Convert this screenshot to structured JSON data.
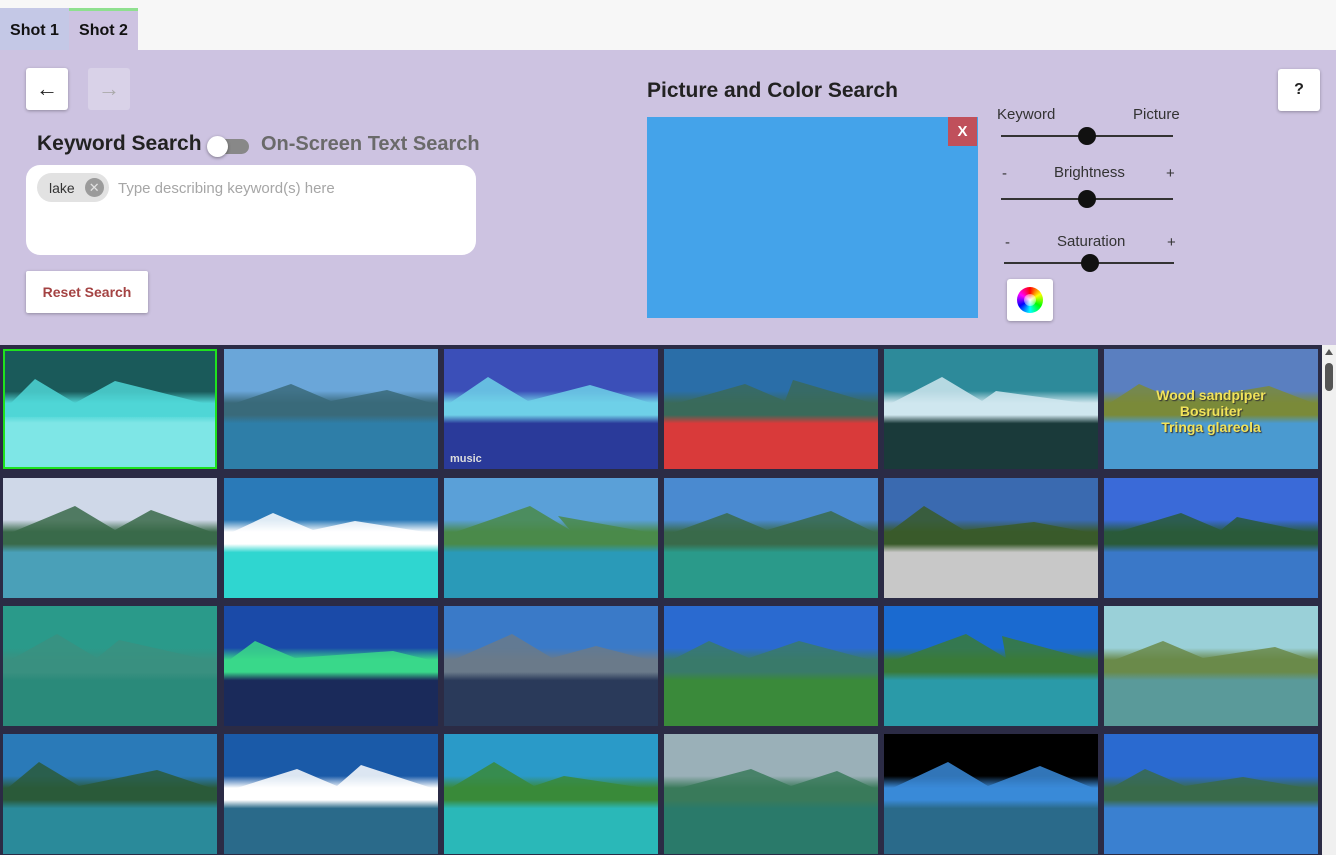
{
  "tabs": [
    {
      "label": "Shot 1"
    },
    {
      "label": "Shot 2"
    }
  ],
  "nav": {
    "back_icon": "←",
    "forward_icon": "→"
  },
  "keyword_search": {
    "title": "Keyword Search",
    "alt_title": "On-Screen Text Search",
    "chips": [
      "lake"
    ],
    "placeholder": "Type describing keyword(s) here",
    "value": "",
    "reset_label": "Reset Search"
  },
  "picture_search": {
    "title": "Picture and Color Search",
    "clear_label": "X",
    "canvas_color": "#44a3ea",
    "sliders": {
      "blend": {
        "left": "Keyword",
        "right": "Picture",
        "value": 0.5
      },
      "brightness": {
        "minus": "-",
        "label": "Brightness",
        "plus": "+",
        "value": 0.5
      },
      "saturation": {
        "minus": "-",
        "label": "Saturation",
        "plus": "+",
        "value": 0.5
      }
    }
  },
  "help": {
    "label": "?"
  },
  "results": {
    "columns": 6,
    "rows": 4,
    "selected_index": 0,
    "thumbnails": [
      {
        "overlay": [],
        "colors": [
          "#1a5a5a",
          "#4fd6d6",
          "#7ee6e6"
        ]
      },
      {
        "overlay": [],
        "colors": [
          "#6aa6d9",
          "#3a6a7a",
          "#2e7ea8"
        ]
      },
      {
        "overlay": [
          "music"
        ],
        "colors": [
          "#3b4fb8",
          "#6fd0e8",
          "#2a3a9a"
        ]
      },
      {
        "overlay": [],
        "colors": [
          "#2a6ea8",
          "#3a6a5a",
          "#d93a3a"
        ]
      },
      {
        "overlay": [],
        "colors": [
          "#2d8a9a",
          "#cfe6ee",
          "#1a3a3a"
        ]
      },
      {
        "overlay": [
          "Wood sandpiper",
          "Bosruiter",
          "Tringa glareola"
        ],
        "colors": [
          "#5a7fc0",
          "#7a8a3a",
          "#4a9ad0"
        ]
      },
      {
        "overlay": [],
        "colors": [
          "#cfd8e8",
          "#3a6a4a",
          "#4aa0b8"
        ]
      },
      {
        "overlay": [],
        "colors": [
          "#2a7ab8",
          "#ffffff",
          "#2fd6d0"
        ]
      },
      {
        "overlay": [],
        "colors": [
          "#5aa0d8",
          "#4a8a4a",
          "#2a9ab8"
        ]
      },
      {
        "overlay": [],
        "colors": [
          "#4a8ad0",
          "#3a6a4a",
          "#2a9a8a"
        ]
      },
      {
        "overlay": [],
        "colors": [
          "#3a6ab0",
          "#3a5a2a",
          "#c8c8c8"
        ]
      },
      {
        "overlay": [],
        "colors": [
          "#3a6ad8",
          "#2a5a3a",
          "#3a78c8"
        ]
      },
      {
        "overlay": [],
        "colors": [
          "#2a9a8a",
          "#3a9080",
          "#2a8a7a"
        ]
      },
      {
        "overlay": [],
        "colors": [
          "#1a4aa8",
          "#3ad88a",
          "#1a2a5a"
        ]
      },
      {
        "overlay": [],
        "colors": [
          "#3a7ac8",
          "#6a7a8a",
          "#2a3a5a"
        ]
      },
      {
        "overlay": [],
        "colors": [
          "#2a6ad0",
          "#3a7a6a",
          "#3a8a3a"
        ]
      },
      {
        "overlay": [],
        "colors": [
          "#1a6ad0",
          "#3a7a3a",
          "#2a9aa8"
        ]
      },
      {
        "overlay": [],
        "colors": [
          "#9ad0d8",
          "#6a8a4a",
          "#5a9a9a"
        ]
      },
      {
        "overlay": [],
        "colors": [
          "#2a7ab8",
          "#2a5a3a",
          "#2a8a9a"
        ]
      },
      {
        "overlay": [],
        "colors": [
          "#1a5aa8",
          "#ffffff",
          "#2a6a8a"
        ]
      },
      {
        "overlay": [],
        "colors": [
          "#2a9ac8",
          "#3a8a3a",
          "#2ab8b8"
        ]
      },
      {
        "overlay": [],
        "colors": [
          "#9ab0b8",
          "#3a7a5a",
          "#2a7a6a"
        ]
      },
      {
        "overlay": [],
        "colors": [
          "#000000",
          "#3a8ad8",
          "#2a6a8a"
        ]
      },
      {
        "overlay": [],
        "colors": [
          "#2a6ad0",
          "#3a6a4a",
          "#3a80d0"
        ]
      }
    ]
  }
}
